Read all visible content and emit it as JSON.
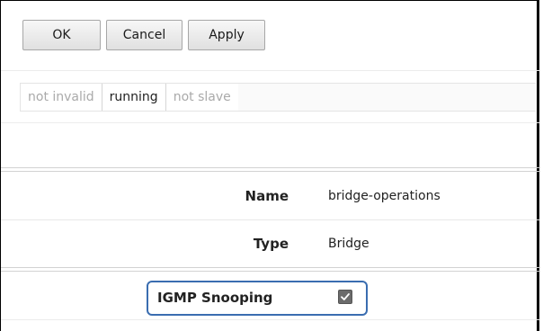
{
  "toolbar": {
    "ok_label": "OK",
    "cancel_label": "Cancel",
    "apply_label": "Apply"
  },
  "status": [
    {
      "label": "not invalid",
      "active": false
    },
    {
      "label": "running",
      "active": true
    },
    {
      "label": "not slave",
      "active": false
    }
  ],
  "form": {
    "name_label": "Name",
    "name_value": "bridge-operations",
    "type_label": "Type",
    "type_value": "Bridge",
    "igmp_label": "IGMP Snooping",
    "igmp_checked": true
  },
  "colors": {
    "highlight": "#3a6db0",
    "checkbox_fill": "#6b6b6b"
  },
  "icons": {
    "checkbox": "checkmark-icon"
  }
}
